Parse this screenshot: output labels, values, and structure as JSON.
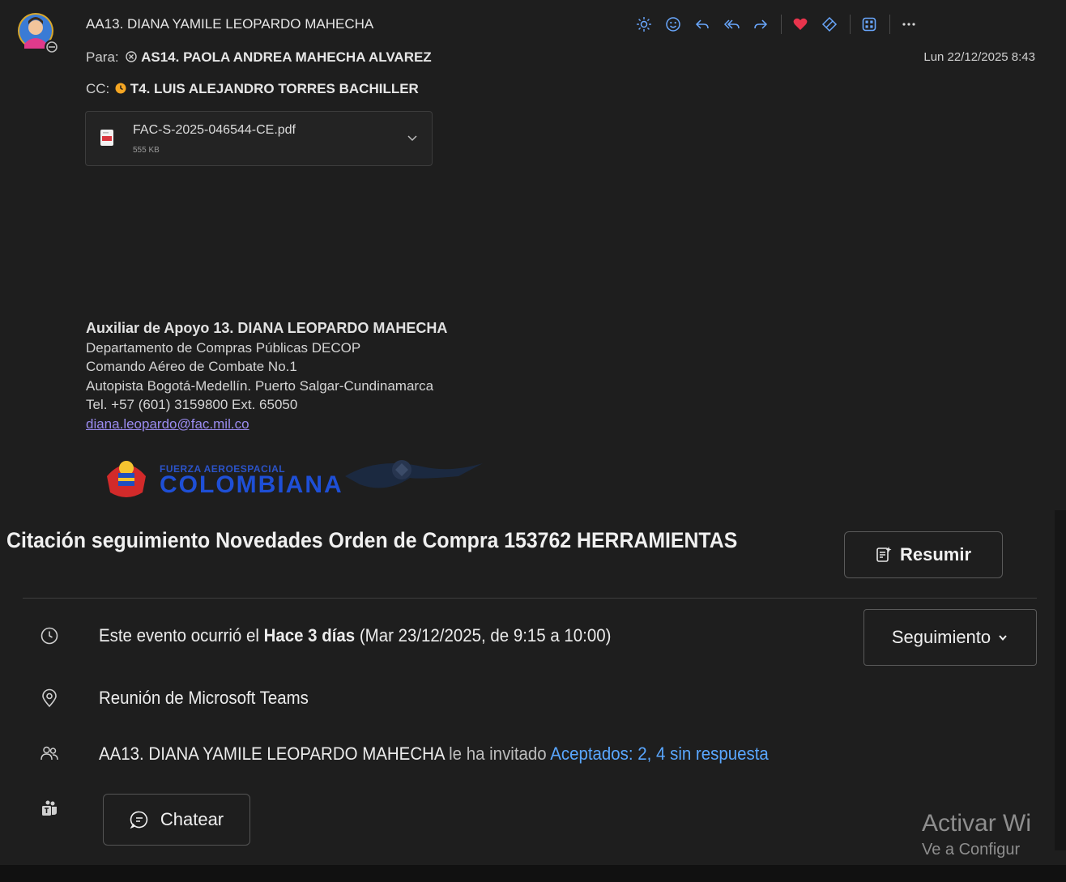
{
  "header": {
    "sender": "AA13. DIANA YAMILE LEOPARDO MAHECHA",
    "to_label": "Para:",
    "to_name": "AS14. PAOLA ANDREA MAHECHA ALVAREZ",
    "cc_label": "CC:",
    "cc_name": "T4. LUIS ALEJANDRO TORRES BACHILLER",
    "date": "Lun 22/12/2025 8:43",
    "toolbar_icons": [
      "sun-icon",
      "smiley-icon",
      "reply-icon",
      "reply-all-icon",
      "forward-icon",
      "heart-icon",
      "tag-icon",
      "apps-icon",
      "more-icon"
    ]
  },
  "attachment": {
    "name": "FAC-S-2025-046544-CE.pdf",
    "size": "555 KB"
  },
  "signature": {
    "name": "Auxiliar de Apoyo 13. DIANA LEOPARDO MAHECHA",
    "line1": "Departamento de Compras Públicas DECOP",
    "line2": "Comando Aéreo de Combate No.1",
    "line3": "Autopista Bogotá-Medellín.  Puerto Salgar-Cundinamarca",
    "line4": "Tel. +57 (601) 3159800  Ext. 65050",
    "email": "diana.leopardo@fac.mil.co",
    "logo_line1": "FUERZA AEROESPACIAL",
    "logo_line2": "COLOMBIANA"
  },
  "event": {
    "title": "Citación seguimiento Novedades  Orden de Compra 153762 HERRAMIENTAS",
    "summarize_label": "Resumir",
    "time_prefix": "Este evento ocurrió el ",
    "time_bold": "Hace 3 días",
    "time_suffix": " (Mar 23/12/2025, de 9:15 a 10:00)",
    "followup_label": "Seguimiento",
    "location": "Reunión de Microsoft Teams",
    "organizer": "AA13. DIANA YAMILE LEOPARDO MAHECHA",
    "invited_text": " le ha invitado ",
    "responses": "Aceptados: 2, 4 sin respuesta",
    "chat_label": "Chatear"
  },
  "watermark": {
    "title": "Activar Wi",
    "subtitle": "Ve a Configur"
  },
  "colors": {
    "background": "#1e1e1e",
    "link": "#5aa7ff",
    "email_link": "#9b8cf0",
    "heart": "#e8344c",
    "toolbar_accent": "#6aa8ff"
  }
}
